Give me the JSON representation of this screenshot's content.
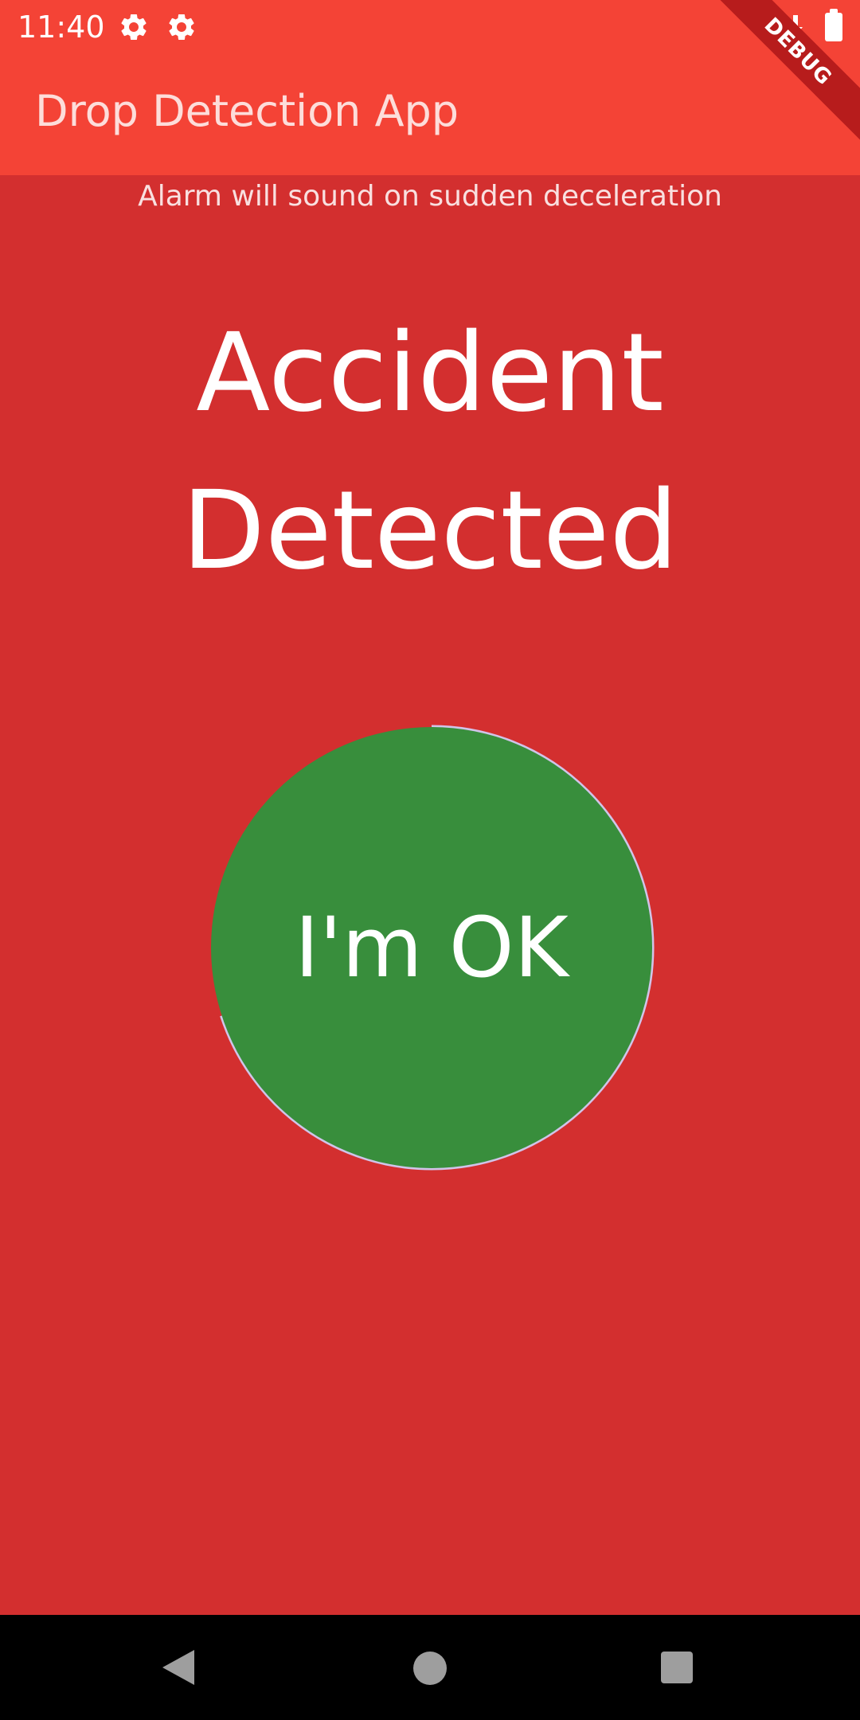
{
  "status_bar": {
    "time": "11:40",
    "icons": [
      "gear-icon",
      "gear-icon",
      "download-icon",
      "battery-icon"
    ]
  },
  "debug_banner": "DEBUG",
  "app_bar": {
    "title": "Drop Detection App"
  },
  "main": {
    "subtitle": "Alarm will sound on sudden deceleration",
    "headline_line1": "Accident",
    "headline_line2": "Detected",
    "ok_button_label": "I'm OK",
    "countdown_progress": 0.7
  },
  "colors": {
    "app_bar": "#f44336",
    "background": "#d32f2f",
    "button": "#388e3c",
    "progress_ring": "#d1c4e9",
    "nav_bar": "#000000"
  },
  "nav_bar": {
    "icons": [
      "back-icon",
      "home-icon",
      "recents-icon"
    ]
  }
}
